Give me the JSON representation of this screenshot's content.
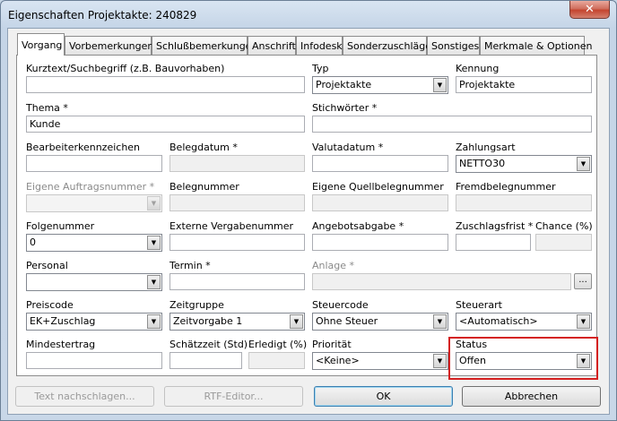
{
  "window": {
    "title": "Eigenschaften Projektakte: 240829",
    "close_label": "✕"
  },
  "tabs": [
    {
      "label": "Vorgang",
      "active": true
    },
    {
      "label": "Vorbemerkungen"
    },
    {
      "label": "Schlußbemerkungen"
    },
    {
      "label": "Anschrift"
    },
    {
      "label": "Infodesk"
    },
    {
      "label": "Sonderzuschläge"
    },
    {
      "label": "Sonstiges"
    },
    {
      "label": "Merkmale & Optionen"
    }
  ],
  "form": {
    "kurztext": {
      "label": "Kurztext/Suchbegriff (z.B. Bauvorhaben)",
      "value": ""
    },
    "typ": {
      "label": "Typ",
      "value": "Projektakte"
    },
    "kennung": {
      "label": "Kennung",
      "value": "Projektakte"
    },
    "thema": {
      "label": "Thema *",
      "value": "Kunde"
    },
    "stichwoerter": {
      "label": "Stichwörter *",
      "value": ""
    },
    "bearbeiter": {
      "label": "Bearbeiterkennzeichen",
      "value": ""
    },
    "belegdatum": {
      "label": "Belegdatum *",
      "value": ""
    },
    "valutadatum": {
      "label": "Valutadatum *",
      "value": ""
    },
    "zahlungsart": {
      "label": "Zahlungsart",
      "value": "NETTO30"
    },
    "eigene_auftragsnummer": {
      "label": "Eigene Auftragsnummer *",
      "value": ""
    },
    "belegnummer": {
      "label": "Belegnummer",
      "value": ""
    },
    "quellbelegnummer": {
      "label": "Eigene Quellbelegnummer",
      "value": ""
    },
    "fremdbelegnummer": {
      "label": "Fremdbelegnummer",
      "value": ""
    },
    "folgenummer": {
      "label": "Folgenummer",
      "value": "0"
    },
    "externe_vergabe": {
      "label": "Externe Vergabenummer",
      "value": ""
    },
    "angebotsabgabe": {
      "label": "Angebotsabgabe *",
      "value": ""
    },
    "zuschlagsfrist": {
      "label": "Zuschlagsfrist *",
      "value": ""
    },
    "chance": {
      "label": "Chance (%)",
      "value": ""
    },
    "personal": {
      "label": "Personal",
      "value": ""
    },
    "termin": {
      "label": "Termin *",
      "value": ""
    },
    "anlage": {
      "label": "Anlage *",
      "value": "",
      "button": "..."
    },
    "preiscode": {
      "label": "Preiscode",
      "value": "EK+Zuschlag"
    },
    "zeitgruppe": {
      "label": "Zeitgruppe",
      "value": "Zeitvorgabe 1"
    },
    "steuercode": {
      "label": "Steuercode",
      "value": "Ohne Steuer"
    },
    "steuerart": {
      "label": "Steuerart",
      "value": "<Automatisch>"
    },
    "mindestertrag": {
      "label": "Mindestertrag",
      "value": ""
    },
    "schaetzzeit": {
      "label": "Schätzzeit (Std)",
      "value": ""
    },
    "erledigt": {
      "label": "Erledigt (%)",
      "value": ""
    },
    "prioritaet": {
      "label": "Priorität",
      "value": "<Keine>"
    },
    "status": {
      "label": "Status",
      "value": "Offen"
    }
  },
  "buttons": {
    "text_nachschlagen": "Text nachschlagen...",
    "rtf_editor": "RTF-Editor...",
    "ok": "OK",
    "abbrechen": "Abbrechen"
  },
  "colors": {
    "highlight": "#d42020",
    "dialog_bg": "#f0f0f0",
    "frame": "#c7d6e6"
  },
  "icons": {
    "dropdown": "chevron-down-icon",
    "close": "close-icon"
  }
}
